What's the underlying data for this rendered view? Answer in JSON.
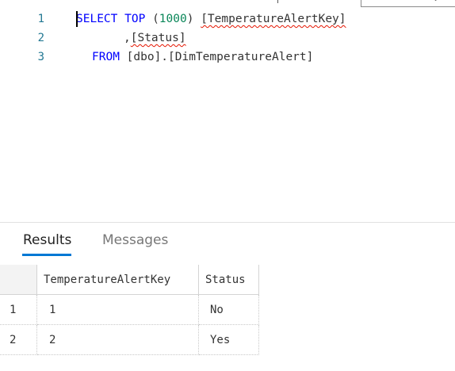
{
  "editor": {
    "lines": [
      {
        "num": "1",
        "parts": {
          "kw1": "SELECT",
          "kw2": "TOP",
          "paren_open": "(",
          "num": "1000",
          "paren_close": ")",
          "ident": "[TemperatureAlertKey]"
        }
      },
      {
        "num": "2",
        "parts": {
          "comma": ",",
          "ident": "[Status]"
        }
      },
      {
        "num": "3",
        "parts": {
          "kw": "FROM",
          "ident": "[dbo].[DimTemperatureAlert]"
        }
      }
    ]
  },
  "tabs": {
    "results": "Results",
    "messages": "Messages"
  },
  "results_grid": {
    "columns": [
      "TemperatureAlertKey",
      "Status"
    ],
    "rows": [
      {
        "row_number": "1",
        "cells": [
          "1",
          "No"
        ]
      },
      {
        "row_number": "2",
        "cells": [
          "2",
          "Yes"
        ]
      }
    ]
  },
  "colors": {
    "keyword": "#0000ff",
    "number": "#098658",
    "line_number": "#237893",
    "error_squiggle": "#e51400",
    "tab_accent": "#0078d4"
  }
}
